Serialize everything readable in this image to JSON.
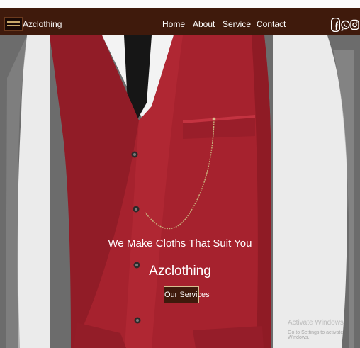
{
  "navbar": {
    "brand": "Azclothing",
    "links": [
      "Home",
      "About",
      "Service",
      "Contact"
    ],
    "social_icons": [
      "facebook-icon",
      "whatsapp-icon",
      "instagram-icon"
    ]
  },
  "hero": {
    "tagline": "We Make Cloths That Suit You",
    "title": "Azclothing",
    "button_label": "Our Services"
  },
  "watermark": {
    "title": "Activate Windows",
    "subtitle": "Go to Settings to activate Windows."
  },
  "colors": {
    "navbar_bg": "#3f1a0c",
    "vest_red": "#a6222e",
    "button_bg": "#3f1a0c"
  }
}
